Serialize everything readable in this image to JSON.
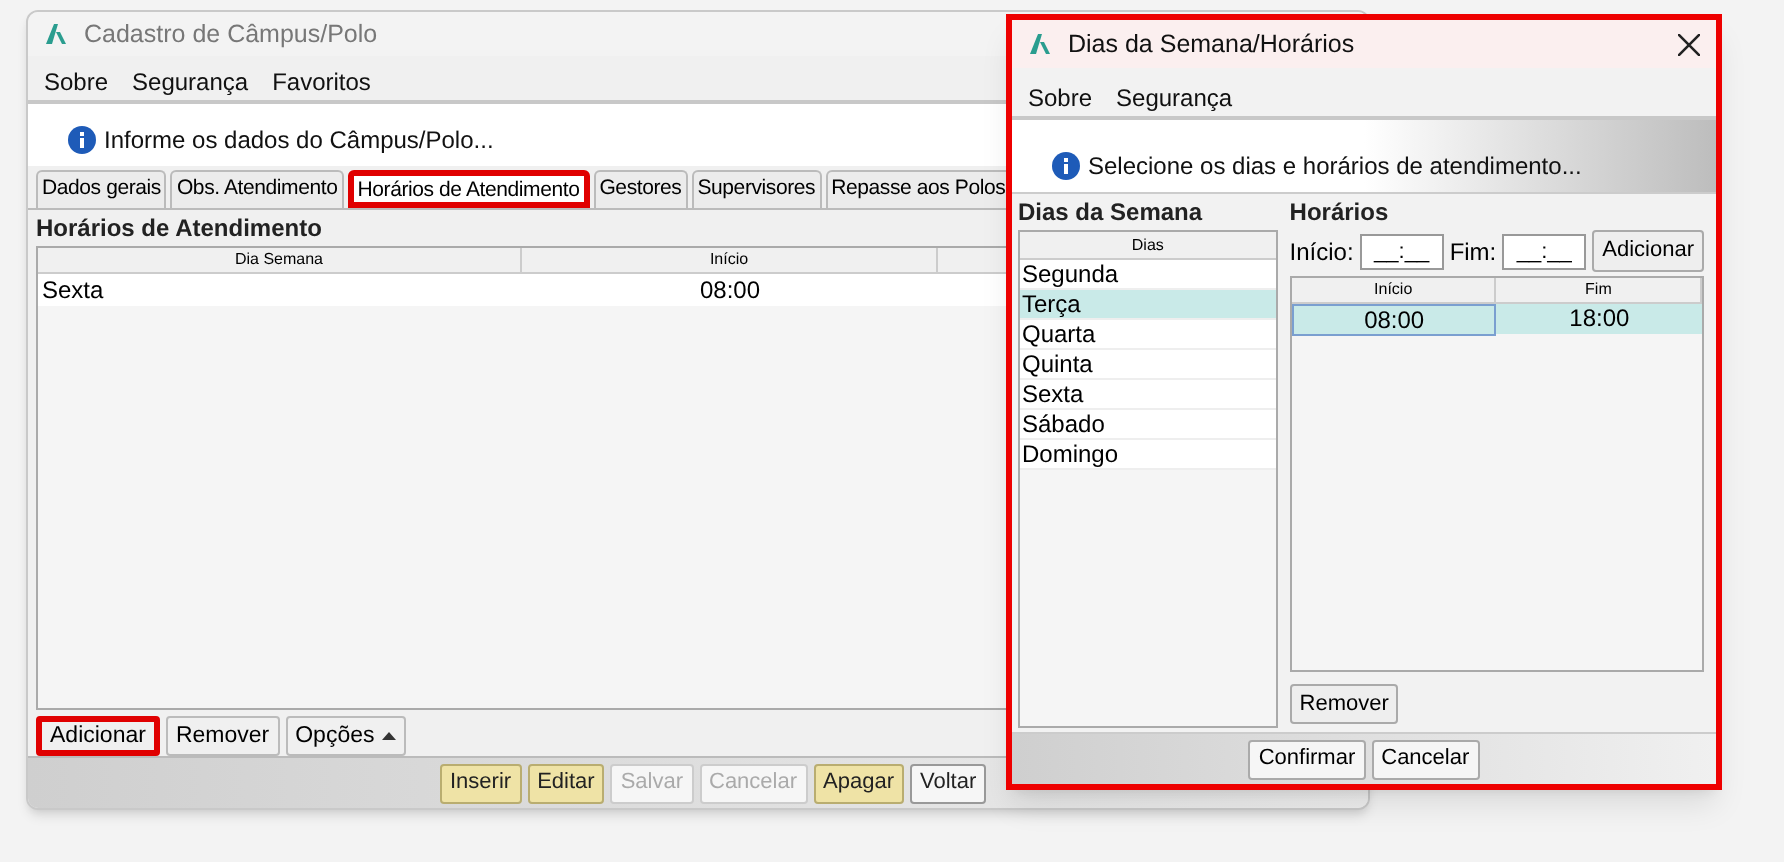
{
  "main_window": {
    "title": "Cadastro de Câmpus/Polo",
    "menu": [
      "Sobre",
      "Segurança",
      "Favoritos"
    ],
    "info": "Informe os dados do Câmpus/Polo...",
    "tabs": [
      {
        "label": "Dados gerais",
        "selected": false,
        "highlighted": false
      },
      {
        "label": "Obs. Atendimento",
        "selected": false,
        "highlighted": false
      },
      {
        "label": "Horários de Atendimento",
        "selected": true,
        "highlighted": true
      },
      {
        "label": "Gestores",
        "selected": false,
        "highlighted": false
      },
      {
        "label": "Supervisores",
        "selected": false,
        "highlighted": false
      },
      {
        "label": "Repasse aos Polos",
        "selected": false,
        "highlighted": false
      }
    ],
    "group_title": "Horários de Atendimento",
    "table": {
      "columns": [
        "Dia Semana",
        "Início"
      ],
      "rows": [
        [
          "Sexta",
          "08:00"
        ]
      ]
    },
    "table_buttons": [
      {
        "label": "Adicionar",
        "highlighted": true,
        "kind": "plain"
      },
      {
        "label": "Remover",
        "highlighted": false,
        "kind": "plain"
      },
      {
        "label": "Opções",
        "highlighted": false,
        "kind": "menu"
      }
    ],
    "footer_buttons": [
      {
        "label": "Inserir",
        "kind": "action",
        "disabled": false
      },
      {
        "label": "Editar",
        "kind": "action",
        "disabled": false
      },
      {
        "label": "Salvar",
        "kind": "plain",
        "disabled": true
      },
      {
        "label": "Cancelar",
        "kind": "plain",
        "disabled": true
      },
      {
        "label": "Apagar",
        "kind": "action",
        "disabled": false
      },
      {
        "label": "Voltar",
        "kind": "plain",
        "disabled": false
      }
    ]
  },
  "dialog": {
    "title": "Dias da Semana/Horários",
    "highlighted": true,
    "menu": [
      "Sobre",
      "Segurança"
    ],
    "info": "Selecione os dias e horários de atendimento...",
    "days_group": "Dias da Semana",
    "days_column": "Dias",
    "days": [
      {
        "label": "Segunda",
        "selected": false
      },
      {
        "label": "Terça",
        "selected": true
      },
      {
        "label": "Quarta",
        "selected": false
      },
      {
        "label": "Quinta",
        "selected": false
      },
      {
        "label": "Sexta",
        "selected": false
      },
      {
        "label": "Sábado",
        "selected": false
      },
      {
        "label": "Domingo",
        "selected": false
      }
    ],
    "hours_group": "Horários",
    "start_label": "Início:",
    "start_value": "__:__",
    "end_label": "Fim:",
    "end_value": "__:__",
    "add_button": "Adicionar",
    "hours_columns": [
      "Início",
      "Fim"
    ],
    "hours_rows": [
      {
        "cells": [
          "08:00",
          "18:00"
        ],
        "selected": true
      }
    ],
    "remove_button": "Remover",
    "buttons": [
      "Confirmar",
      "Cancelar"
    ]
  }
}
